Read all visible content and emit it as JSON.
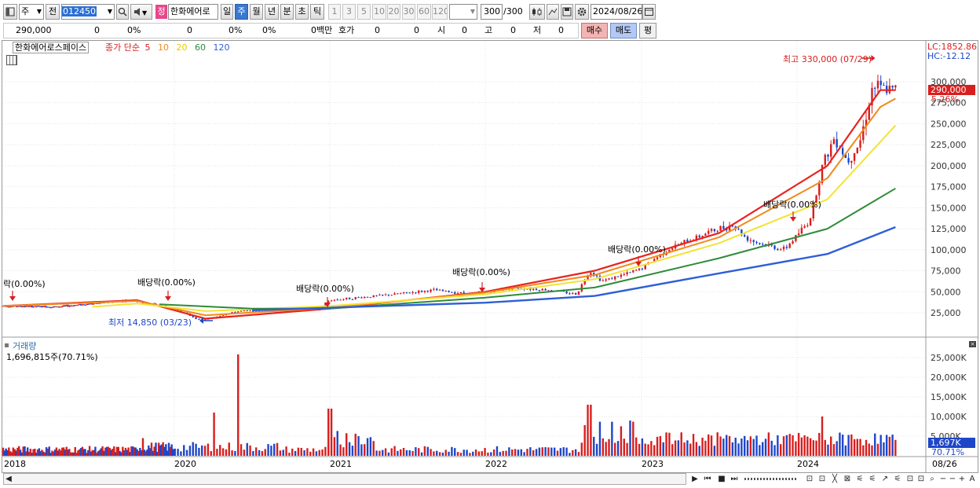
{
  "toolbar": {
    "mode": "주",
    "prev": "전",
    "code": "012450",
    "name_badge": "정",
    "name": "한화에어로",
    "periods": [
      "일",
      "주",
      "월",
      "년",
      "분",
      "초",
      "틱"
    ],
    "active_period": "주",
    "intervals": [
      "1",
      "3",
      "5",
      "10",
      "20",
      "30",
      "60",
      "120"
    ],
    "count": "300",
    "count_total": "/300",
    "date": "2024/08/26"
  },
  "quote": {
    "price": "290,000",
    "change": "0",
    "change_pct": "0%",
    "volume": "0",
    "vol_pct": "0%",
    "vol_pct2": "0%",
    "trade_value": "0백만",
    "hoga_label": "호가",
    "hoga1": "0",
    "hoga2": "0",
    "open_label": "시",
    "open": "0",
    "high_label": "고",
    "high": "0",
    "low_label": "저",
    "low": "0",
    "buy": "매수",
    "sell": "매도",
    "eval": "평"
  },
  "price_panel": {
    "stock_label": "한화에어로스페이스",
    "indicator_prefix": "종가 단순",
    "ma_periods": [
      "5",
      "10",
      "20",
      "60",
      "120"
    ],
    "lc": "LC:1852.86",
    "hc": "HC:-12.12",
    "high_note": "최고 330,000 (07/29)",
    "low_note": "최저 14,850 (03/23)",
    "current_price": "290,000",
    "current_pct": "5.26%",
    "div_notes": [
      "락(0.00%)",
      "배당락(0.00%)",
      "배당락(0.00%)",
      "배당락(0.00%)",
      "배당락(0.00%)",
      "배당락(0.00%)"
    ]
  },
  "volume_panel": {
    "title": "거래량",
    "value": "1,696,815주(70.71%)",
    "current": "1,697K",
    "current_pct": "70.71%"
  },
  "x_axis": {
    "labels": [
      "2018",
      "2020",
      "2021",
      "2022",
      "2023",
      "2024"
    ],
    "last_date": "08/26"
  },
  "colors": {
    "ma5": "#e8231e",
    "ma10": "#f08a1c",
    "ma20": "#f4e236",
    "ma60": "#2e8b3a",
    "ma120": "#2f5fd6",
    "up": "#d81e1e",
    "down": "#1e46c8"
  },
  "chart_data": [
    {
      "type": "line",
      "title": "한화에어로스페이스",
      "x_range": [
        "2017-09",
        "2024-08"
      ],
      "ylim": [
        0,
        330000
      ],
      "y_ticks": [
        25000,
        50000,
        75000,
        100000,
        125000,
        150000,
        175000,
        200000,
        225000,
        250000,
        275000,
        300000
      ],
      "y_tick_labels": [
        "25,000",
        "50,000",
        "75,000",
        "100,000",
        "125,000",
        "150,000",
        "175,000",
        "200,000",
        "225,000",
        "250,000",
        "275,000",
        "300,000"
      ],
      "close": [
        [
          "2017-09",
          33000
        ],
        [
          "2018-06",
          32000
        ],
        [
          "2019-06",
          40000
        ],
        [
          "2019-09",
          36000
        ],
        [
          "2020-01",
          30000
        ],
        [
          "2020-03",
          16000
        ],
        [
          "2020-06",
          27000
        ],
        [
          "2020-12",
          28000
        ],
        [
          "2021-01",
          40000
        ],
        [
          "2021-06",
          47000
        ],
        [
          "2021-09",
          52000
        ],
        [
          "2021-12",
          47000
        ],
        [
          "2022-03",
          55000
        ],
        [
          "2022-06",
          52000
        ],
        [
          "2022-08",
          47000
        ],
        [
          "2022-09",
          75000
        ],
        [
          "2022-10",
          63000
        ],
        [
          "2022-12",
          72000
        ],
        [
          "2023-01",
          78000
        ],
        [
          "2023-03",
          100000
        ],
        [
          "2023-06",
          120000
        ],
        [
          "2023-08",
          130000
        ],
        [
          "2023-09",
          115000
        ],
        [
          "2023-10",
          108000
        ],
        [
          "2023-12",
          100000
        ],
        [
          "2024-02",
          135000
        ],
        [
          "2024-03",
          200000
        ],
        [
          "2024-04",
          235000
        ],
        [
          "2024-05",
          205000
        ],
        [
          "2024-06",
          230000
        ],
        [
          "2024-07",
          295000
        ],
        [
          "2024-08",
          290000
        ]
      ],
      "series": [
        {
          "name": "5",
          "values": [
            [
              2017.7,
              33000
            ],
            [
              2019.5,
              40000
            ],
            [
              2020.2,
              18000
            ],
            [
              2021.0,
              30000
            ],
            [
              2022.0,
              50000
            ],
            [
              2022.7,
              75000
            ],
            [
              2023.5,
              120000
            ],
            [
              2024.2,
              200000
            ],
            [
              2024.55,
              290000
            ],
            [
              2024.65,
              290000
            ]
          ]
        },
        {
          "name": "10",
          "values": [
            [
              2017.7,
              33000
            ],
            [
              2019.5,
              39000
            ],
            [
              2020.2,
              22000
            ],
            [
              2021.0,
              31000
            ],
            [
              2022.0,
              49000
            ],
            [
              2022.7,
              70000
            ],
            [
              2023.5,
              115000
            ],
            [
              2024.2,
              185000
            ],
            [
              2024.55,
              270000
            ],
            [
              2024.65,
              280000
            ]
          ]
        },
        {
          "name": "20",
          "values": [
            [
              2018.9,
              32000
            ],
            [
              2019.5,
              36000
            ],
            [
              2020.2,
              27000
            ],
            [
              2021.0,
              33000
            ],
            [
              2022.0,
              47000
            ],
            [
              2022.7,
              65000
            ],
            [
              2023.5,
              108000
            ],
            [
              2024.2,
              160000
            ],
            [
              2024.65,
              248000
            ]
          ]
        },
        {
          "name": "60",
          "values": [
            [
              2019.8,
              35000
            ],
            [
              2020.5,
              30000
            ],
            [
              2021.0,
              30000
            ],
            [
              2022.0,
              43000
            ],
            [
              2022.7,
              55000
            ],
            [
              2023.5,
              90000
            ],
            [
              2024.2,
              125000
            ],
            [
              2024.65,
              173000
            ]
          ]
        },
        {
          "name": "120",
          "values": [
            [
              2020.5,
              28000
            ],
            [
              2021.0,
              31000
            ],
            [
              2022.0,
              37000
            ],
            [
              2022.7,
              45000
            ],
            [
              2023.5,
              72000
            ],
            [
              2024.2,
              95000
            ],
            [
              2024.65,
              127000
            ]
          ]
        }
      ]
    },
    {
      "type": "bar",
      "title": "거래량",
      "ylim": [
        0,
        27000
      ],
      "y_ticks": [
        5000,
        10000,
        15000,
        20000,
        25000
      ],
      "y_tick_labels": [
        "5,000K",
        "10,000K",
        "15,000K",
        "20,000K",
        "25,000K"
      ],
      "notable_bars_k": [
        [
          "2019-08",
          4500
        ],
        [
          "2020-04",
          11000
        ],
        [
          "2020-06",
          25800
        ],
        [
          "2021-01",
          12000
        ],
        [
          "2022-09",
          13000
        ],
        [
          "2024-03",
          10000
        ]
      ]
    }
  ]
}
